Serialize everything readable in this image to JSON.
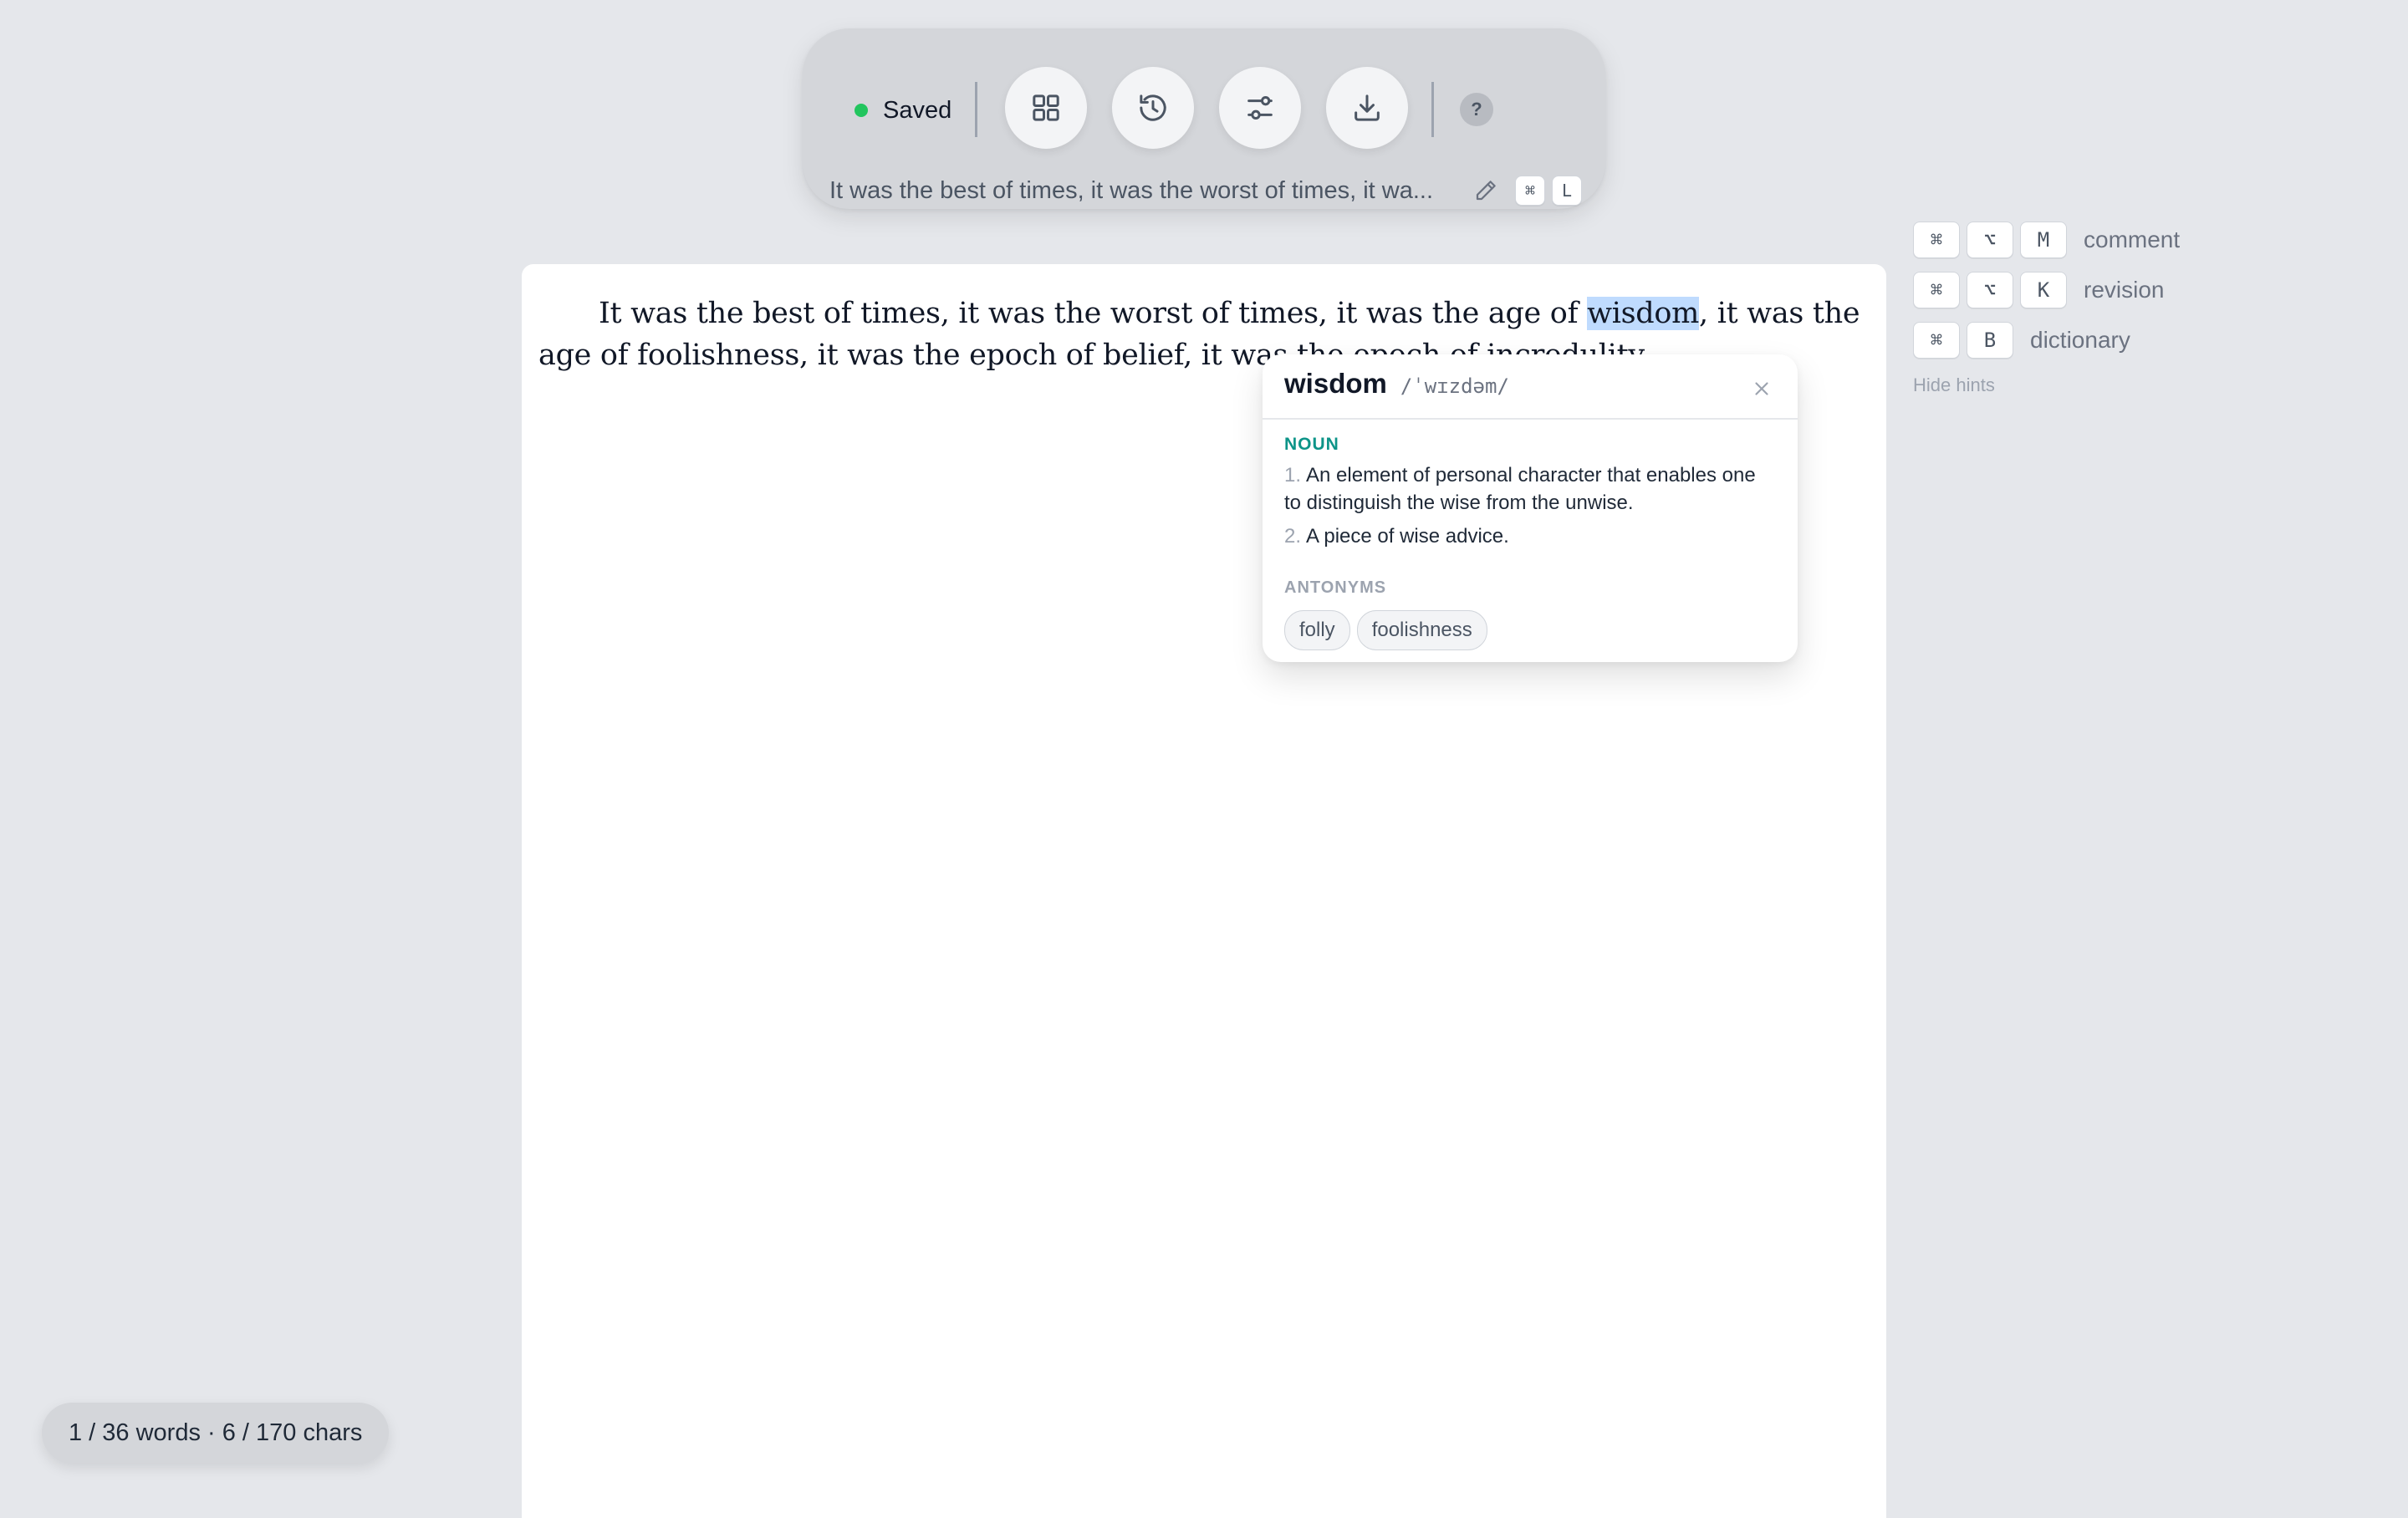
{
  "toolbar": {
    "status_text": "Saved",
    "status_color": "#22c55e",
    "buttons": [
      {
        "name": "grid-icon",
        "label": "Layout"
      },
      {
        "name": "history-icon",
        "label": "History"
      },
      {
        "name": "sliders-icon",
        "label": "Settings"
      },
      {
        "name": "download-icon",
        "label": "Download"
      }
    ],
    "help_label": "?",
    "doc_title": "It was the best of times, it was the worst of times, it wa...",
    "title_shortcut": [
      "⌘",
      "L"
    ]
  },
  "hints": {
    "items": [
      {
        "keys": [
          "⌘",
          "⌥",
          "M"
        ],
        "label": "comment"
      },
      {
        "keys": [
          "⌘",
          "⌥",
          "K"
        ],
        "label": "revision"
      },
      {
        "keys": [
          "⌘",
          "B"
        ],
        "label": "dictionary"
      }
    ],
    "hide_label": "Hide hints"
  },
  "editor": {
    "text_before": "It was the best of times, it was the worst of times, it was the age of ",
    "selected": "wisdom",
    "text_after": ", it was the age of foolishness, it was the epoch of belief, it was the epoch of incredulity..."
  },
  "dictionary": {
    "word": "wisdom",
    "pronunciation": "/ˈwɪzdəm/",
    "part_of_speech": "NOUN",
    "definitions": [
      {
        "num": "1.",
        "text": "An element of personal character that enables one to distinguish the wise from the unwise."
      },
      {
        "num": "2.",
        "text": "A piece of wise advice."
      }
    ],
    "antonyms_label": "ANTONYMS",
    "antonyms": [
      "folly",
      "foolishness"
    ],
    "accent_color": "#0d9488"
  },
  "status_bar": {
    "word_count": "1 / 36 words · 6 / 170 chars"
  },
  "colors": {
    "background": "#e5e7eb",
    "selection": "#bfdbfe"
  }
}
